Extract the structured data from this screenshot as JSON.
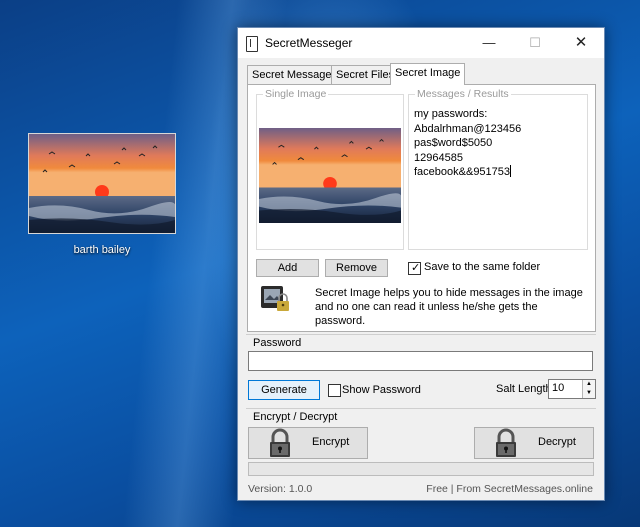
{
  "desktop": {
    "icon_label": "barth bailey"
  },
  "window": {
    "title": "SecretMesseger",
    "controls": {
      "minimize": "—",
      "maximize": "☐",
      "close": "✕"
    }
  },
  "tabs": [
    {
      "label": "Secret Messages",
      "active": false
    },
    {
      "label": "Secret Files",
      "active": false
    },
    {
      "label": "Secret Image",
      "active": true
    }
  ],
  "secret_image": {
    "single_image_legend": "Single Image",
    "messages_legend": "Messages / Results",
    "messages": [
      "my passwords:",
      "Abdalrhman@123456",
      "pas$word$5050",
      "12964585",
      "facebook&&951753"
    ],
    "add_label": "Add",
    "remove_label": "Remove",
    "save_same_folder_label": "Save to the same folder",
    "save_same_folder_checked": true,
    "info_text": "Secret Image helps you to hide messages in the image and no one can read it unless he/she gets the password."
  },
  "password_section": {
    "title": "Password",
    "value": "",
    "generate_label": "Generate",
    "show_password_label": "Show Password",
    "show_password_checked": false,
    "salt_label": "Salt Length:",
    "salt_value": "10"
  },
  "encrypt_section": {
    "title": "Encrypt / Decrypt",
    "encrypt_label": "Encrypt",
    "decrypt_label": "Decrypt",
    "progress": 0
  },
  "status": {
    "version": "Version: 1.0.0",
    "footer": "Free | From SecretMessages.online"
  },
  "colors": {
    "desktop_bg": "#0d62bb",
    "window_bg": "#f0f0f0",
    "focus_accent": "#0078d7"
  }
}
